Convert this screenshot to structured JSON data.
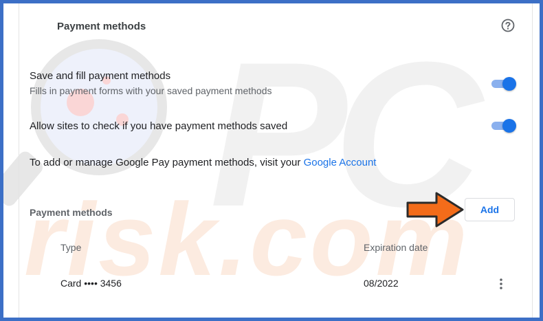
{
  "colors": {
    "accent": "#1a73e8",
    "frame_border": "#3c6fc6",
    "arrow": "#f36c1a"
  },
  "header": {
    "title": "Payment methods",
    "help_icon": "help-circle-icon"
  },
  "settings": {
    "save_fill": {
      "title": "Save and fill payment methods",
      "subtitle": "Fills in payment forms with your saved payment methods",
      "enabled": true
    },
    "allow_check": {
      "title": "Allow sites to check if you have payment methods saved",
      "enabled": true
    },
    "google_pay": {
      "text": "To add or manage Google Pay payment methods, visit your ",
      "link": "Google Account"
    }
  },
  "payment_section": {
    "label": "Payment methods",
    "add_label": "Add",
    "columns": [
      "Type",
      "Expiration date"
    ],
    "rows": [
      {
        "type": "Card •••• 3456",
        "expiration": "08/2022",
        "menu_icon": "more-vert-icon"
      }
    ]
  }
}
